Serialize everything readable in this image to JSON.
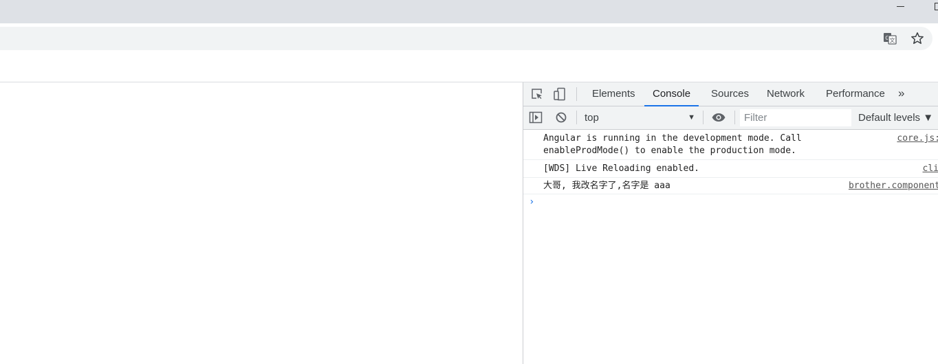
{
  "browser": {
    "translate_icon": "translate-icon",
    "bookmark_icon": "star-icon"
  },
  "devtools": {
    "tabs": [
      {
        "label": "Elements",
        "active": false
      },
      {
        "label": "Console",
        "active": true
      },
      {
        "label": "Sources",
        "active": false
      },
      {
        "label": "Network",
        "active": false
      },
      {
        "label": "Performance",
        "active": false
      }
    ],
    "more_tabs": "»",
    "toolbar": {
      "context": "top",
      "filter_placeholder": "Filter",
      "levels": "Default levels ▼"
    }
  },
  "console": {
    "messages": [
      {
        "text": "Angular is running in the development mode. Call\nenableProdMode() to enable the production mode.",
        "source": "core.js:"
      },
      {
        "text": "[WDS] Live Reloading enabled.",
        "source": "cli"
      },
      {
        "text": "大哥, 我改名字了,名字是 aaa",
        "source": "brother.component"
      }
    ],
    "prompt": "›"
  },
  "colors": {
    "accent": "#1a73e8",
    "titlebar": "#dee1e6",
    "toolbar_bg": "#f1f3f4"
  }
}
